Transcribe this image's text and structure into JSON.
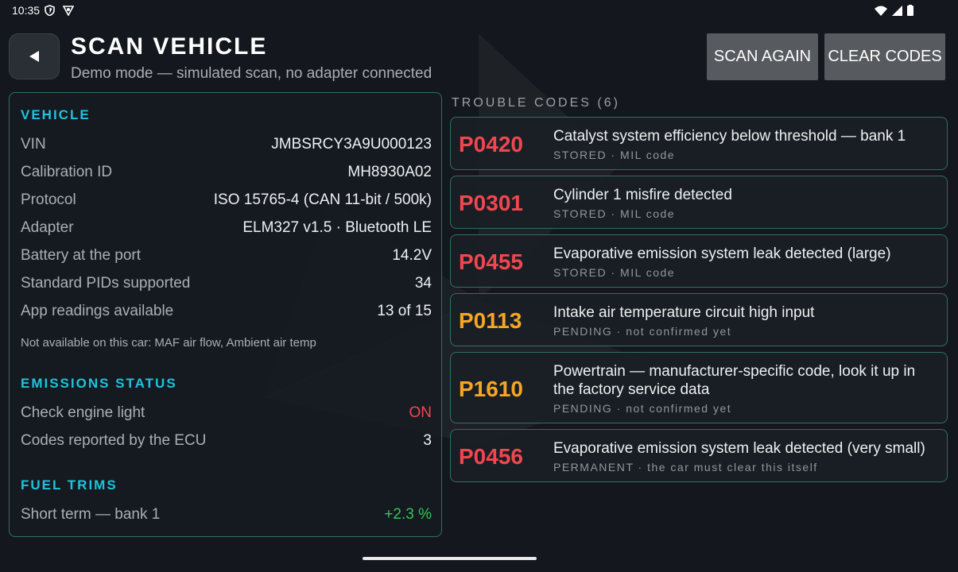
{
  "status_bar": {
    "time": "10:35",
    "icons": [
      "shield-icon",
      "vpn-icon",
      "wifi-icon",
      "signal-icon",
      "battery-icon"
    ]
  },
  "header": {
    "back_icon": "back-arrow-icon",
    "title": "SCAN VEHICLE",
    "subtitle": "Demo mode — simulated scan, no adapter connected",
    "scan_again_label": "SCAN AGAIN",
    "clear_codes_label": "CLEAR CODES"
  },
  "vehicle": {
    "heading": "VEHICLE",
    "rows": [
      {
        "label": "VIN",
        "value": "JMBSRCY3A9U000123"
      },
      {
        "label": "Calibration ID",
        "value": "MH8930A02"
      },
      {
        "label": "Protocol",
        "value": "ISO 15765-4 (CAN 11-bit / 500k)"
      },
      {
        "label": "Adapter",
        "value": "ELM327 v1.5 · Bluetooth LE"
      },
      {
        "label": "Battery at the port",
        "value": "14.2V"
      },
      {
        "label": "Standard PIDs supported",
        "value": "34"
      },
      {
        "label": "App readings available",
        "value": "13 of 15"
      }
    ],
    "note": "Not available on this car: MAF air flow, Ambient air temp"
  },
  "emissions": {
    "heading": "EMISSIONS STATUS",
    "rows": [
      {
        "label": "Check engine light",
        "value": "ON"
      },
      {
        "label": "Codes reported by the ECU",
        "value": "3"
      }
    ]
  },
  "fuel_trims": {
    "heading": "FUEL TRIMS",
    "rows": [
      {
        "label": "Short term — bank 1",
        "value": "+2.3 %"
      }
    ]
  },
  "codes": {
    "heading": "TROUBLE CODES (6)",
    "items": [
      {
        "code": "P0420",
        "description": "Catalyst system efficiency below threshold — bank 1",
        "meta": "STORED · MIL code"
      },
      {
        "code": "P0301",
        "description": "Cylinder 1 misfire detected",
        "meta": "STORED · MIL code"
      },
      {
        "code": "P0455",
        "description": "Evaporative emission system leak detected (large)",
        "meta": "STORED · MIL code"
      },
      {
        "code": "P0113",
        "description": "Intake air temperature circuit high input",
        "meta": "PENDING · not confirmed yet"
      },
      {
        "code": "P1610",
        "description": "Powertrain — manufacturer-specific code, look it up in the factory service data",
        "meta": "PENDING · not confirmed yet"
      },
      {
        "code": "P0456",
        "description": "Evaporative emission system leak detected (very small)",
        "meta": "PERMANENT · the car must clear this itself"
      }
    ]
  },
  "colors": {
    "accent": "#1fc3dd",
    "stored_code": "#f0474f",
    "pending_code": "#f5a623",
    "alert_value": "#f0474f",
    "positive_value": "#35c759",
    "card_border": "#2f6f68"
  }
}
